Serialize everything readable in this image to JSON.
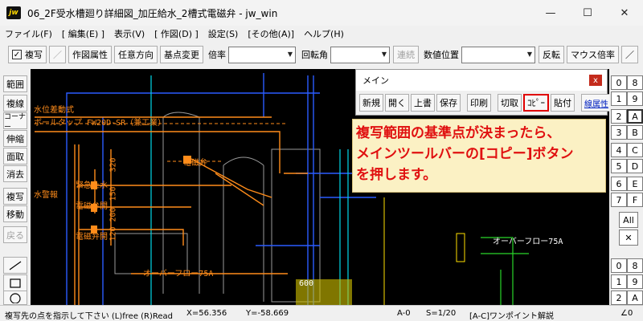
{
  "window": {
    "app_icon": "jw",
    "title": "06_2F受水槽廻り詳細図_加圧給水_2槽式電磁弁 - jw_win",
    "min": "—",
    "max": "☐",
    "close": "✕"
  },
  "menu": [
    "ファイル(F)",
    "[ 編集(E) ]",
    "表示(V)",
    "[ 作図(D) ]",
    "設定(S)",
    "[その他(A)]",
    "ヘルプ(H)"
  ],
  "toolbar": {
    "check_mark": "✓",
    "fukusha": "複写",
    "sakuzu_zokusei": "作図属性",
    "nin_i_houkou": "任意方向",
    "kijun_henkou": "基点変更",
    "bairitsu": "倍率",
    "kaitenkaku": "回転角",
    "renzoku": "連続",
    "suuchi_ichi": "数値位置",
    "hanten": "反転",
    "mouse_bairitsu": "マウス倍率",
    "slash": "／"
  },
  "left_tools": [
    "範囲",
    "複線",
    "コーナー",
    "伸縮",
    "面取",
    "消去",
    "複写",
    "移動",
    "戻る"
  ],
  "left_shapes": [
    "line-tool-icon",
    "rectangle-tool-icon",
    "circle-tool-icon"
  ],
  "right_layers": {
    "col1": [
      "0",
      "1",
      "2",
      "3",
      "4",
      "5",
      "6",
      "7"
    ],
    "col2": [
      "8",
      "9",
      "A",
      "B",
      "C",
      "D",
      "E",
      "F"
    ],
    "all": "All",
    "x": "✕",
    "grp1": [
      "0",
      "1",
      "2"
    ],
    "grp2": [
      "8",
      "9",
      "A"
    ]
  },
  "main_panel": {
    "title": "メイン",
    "close": "x",
    "buttons": [
      "新規",
      "開く",
      "上書",
      "保存",
      "印刷",
      "切取",
      "ｺﾋﾟｰ",
      "貼付",
      "線属性"
    ]
  },
  "callout": {
    "line1": "複写範囲の基準点が決まったら、",
    "line2": "メインツールバーの[コピー]ボタン",
    "line3": "を押します。"
  },
  "cad_labels": {
    "l1": "水位差動式",
    "l2": "ボールタップ FW20D-SR（兼工業）",
    "l3": "緊急止水",
    "l4": "水警報",
    "l5": "電磁弁開",
    "l6": "電磁弁開",
    "l7": "オーバーフロー75A",
    "l8": "オーバーフロー75A",
    "l9": "電磁弁",
    "d1": "320",
    "d2": "150",
    "d3": "200",
    "d4": "120",
    "d5": "600"
  },
  "status": {
    "prompt": "複写先の点を指示して下さい (L)free (R)Read",
    "x": "X=56.356",
    "y": "Y=-58.669",
    "layer": "A-0",
    "scale": "S=1/20",
    "hint": "[A-C]ワンポイント解説",
    "angle": "∠0"
  },
  "colors": {
    "canvas": "#000000",
    "orange": "#ff8c1a",
    "blue": "#2a5cff",
    "cyan": "#00d8e8",
    "green": "#29d629",
    "yellow": "#ffe000",
    "grey": "#9a9a9a",
    "highlight_red": "#e00000"
  }
}
